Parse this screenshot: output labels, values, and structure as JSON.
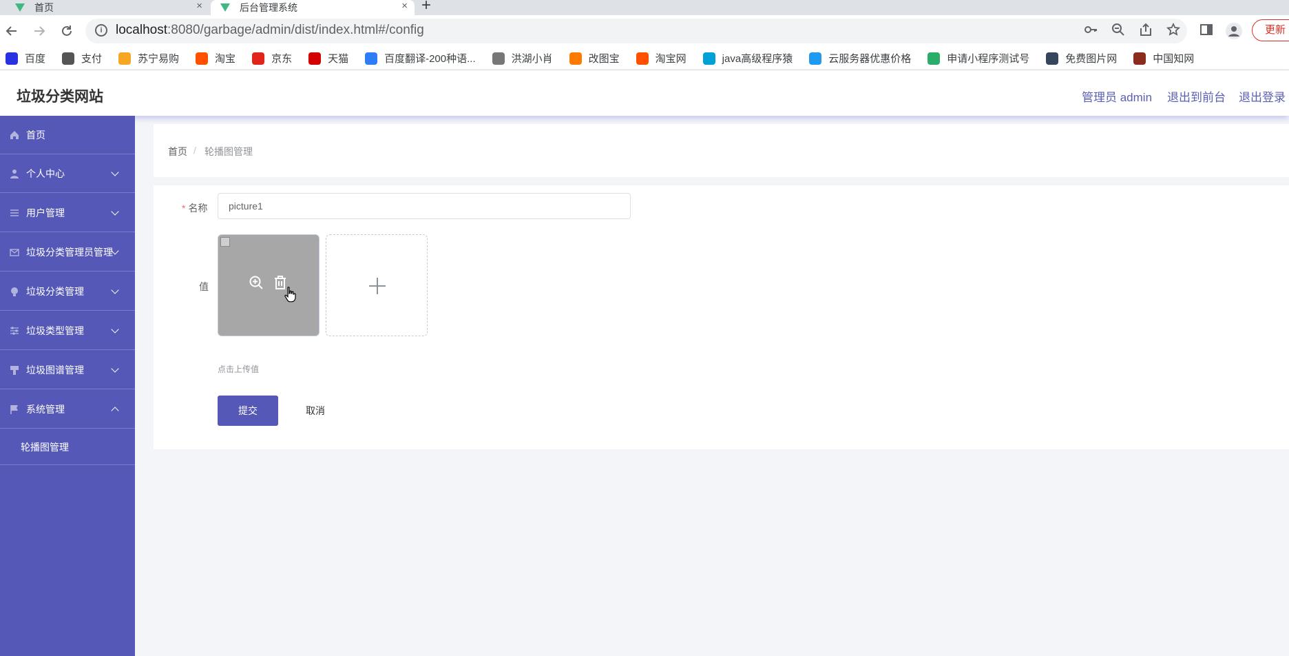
{
  "browser": {
    "tabs": [
      {
        "title": "首页"
      },
      {
        "title": "后台管理系统"
      }
    ],
    "new_tab": "+",
    "close_glyph": "×",
    "url_host": "localhost",
    "url_path": ":8080/garbage/admin/dist/index.html#/config",
    "update_label": "更新",
    "bookmarks": [
      {
        "label": "百度",
        "color": "#2932e1"
      },
      {
        "label": "支付",
        "color": "#555555"
      },
      {
        "label": "苏宁易购",
        "color": "#f5a623"
      },
      {
        "label": "淘宝",
        "color": "#ff5000"
      },
      {
        "label": "京东",
        "color": "#e1251b"
      },
      {
        "label": "天猫",
        "color": "#d40000"
      },
      {
        "label": "百度翻译-200种语...",
        "color": "#2e7cf6"
      },
      {
        "label": "洪湖小肖",
        "color": "#777777"
      },
      {
        "label": "改图宝",
        "color": "#ff7a00"
      },
      {
        "label": "淘宝网",
        "color": "#ff5000"
      },
      {
        "label": "java高级程序猿",
        "color": "#00a1d6"
      },
      {
        "label": "云服务器优惠价格",
        "color": "#1e9bf0"
      },
      {
        "label": "申请小程序测试号",
        "color": "#2aae67"
      },
      {
        "label": "免费图片网",
        "color": "#35465c"
      },
      {
        "label": "中国知网",
        "color": "#8b2c1e"
      }
    ]
  },
  "header": {
    "site_title": "垃圾分类网站",
    "admin_label": "管理员 admin",
    "to_front_label": "退出到前台",
    "logout_label": "退出登录"
  },
  "sidebar": {
    "items": [
      {
        "label": "首页",
        "icon": "home-icon"
      },
      {
        "label": "个人中心",
        "icon": "user-icon"
      },
      {
        "label": "用户管理",
        "icon": "list-icon"
      },
      {
        "label": "垃圾分类管理员管理",
        "icon": "message-icon"
      },
      {
        "label": "垃圾分类管理",
        "icon": "bulb-icon"
      },
      {
        "label": "垃圾类型管理",
        "icon": "sliders-icon"
      },
      {
        "label": "垃圾图谱管理",
        "icon": "brush-icon"
      },
      {
        "label": "系统管理",
        "icon": "flag-icon"
      }
    ],
    "sub_item": "轮播图管理"
  },
  "breadcrumb": {
    "home": "首页",
    "separator": "/",
    "current": "轮播图管理"
  },
  "form": {
    "name_label": "名称",
    "required_mark": "*",
    "name_value": "picture1",
    "value_label": "值",
    "upload_tip": "点击上传值",
    "submit_label": "提交",
    "cancel_label": "取消"
  },
  "colors": {
    "primary": "#5558b7",
    "sidebar_bg": "#5558b7",
    "required": "#f56c6c"
  }
}
